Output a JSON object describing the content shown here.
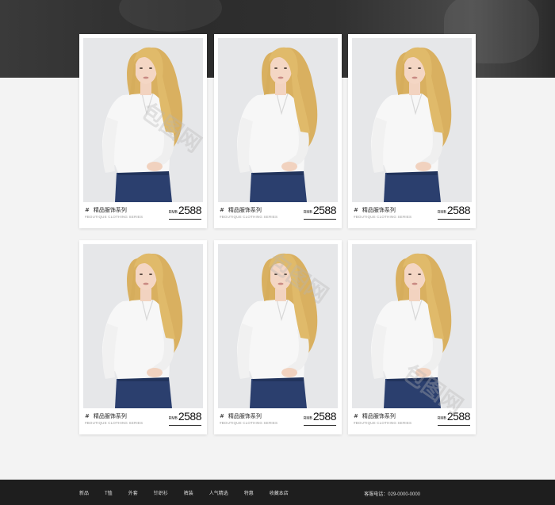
{
  "products": [
    {
      "title": "精品服饰系列",
      "subtitle": "#BOUTIQUE CLOTHING SERIES",
      "currency": "RMB",
      "price": "2588"
    },
    {
      "title": "精品服饰系列",
      "subtitle": "#BOUTIQUE CLOTHING SERIES",
      "currency": "RMB",
      "price": "2588"
    },
    {
      "title": "精品服饰系列",
      "subtitle": "#BOUTIQUE CLOTHING SERIES",
      "currency": "RMB",
      "price": "2588"
    },
    {
      "title": "精品服饰系列",
      "subtitle": "#BOUTIQUE CLOTHING SERIES",
      "currency": "RMB",
      "price": "2588"
    },
    {
      "title": "精品服饰系列",
      "subtitle": "#BOUTIQUE CLOTHING SERIES",
      "currency": "RMB",
      "price": "2588"
    },
    {
      "title": "精品服饰系列",
      "subtitle": "#BOUTIQUE CLOTHING SERIES",
      "currency": "RMB",
      "price": "2588"
    }
  ],
  "caption_prefix": "#",
  "footer": {
    "nav": [
      "新品",
      "T恤",
      "外套",
      "针织衫",
      "裤装",
      "人气精选",
      "特惠",
      "收藏本店"
    ],
    "service": "客服电话：029-0000-0000"
  },
  "watermark": "包图网",
  "colors": {
    "footer_bg": "#1e1e1e",
    "page_bg": "#f3f3f3",
    "hero_bg": "#2c2c2c"
  }
}
